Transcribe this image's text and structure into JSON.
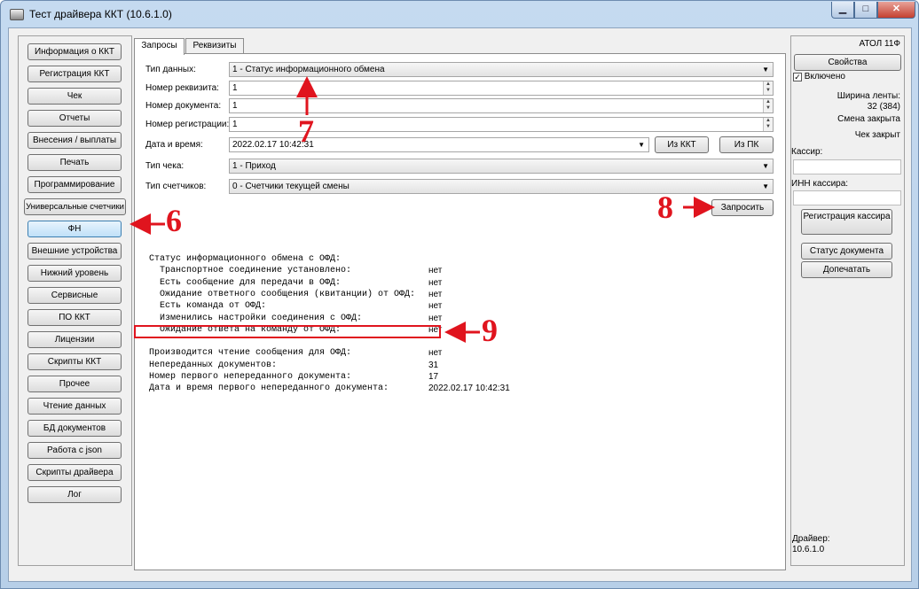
{
  "window": {
    "title": "Тест драйвера ККТ (10.6.1.0)",
    "min_glyph": "▁",
    "max_glyph": "□",
    "close_glyph": "✕"
  },
  "nav": {
    "items": [
      {
        "label": "Информация о ККТ"
      },
      {
        "label": "Регистрация ККТ"
      },
      {
        "label": "Чек"
      },
      {
        "label": "Отчеты"
      },
      {
        "label": "Внесения / выплаты"
      },
      {
        "label": "Печать"
      },
      {
        "label": "Программирование"
      },
      {
        "label": "Универсальные счетчики"
      },
      {
        "label": "ФН",
        "active": true
      },
      {
        "label": "Внешние устройства"
      },
      {
        "label": "Нижний уровень"
      },
      {
        "label": "Сервисные"
      },
      {
        "label": "ПО ККТ"
      },
      {
        "label": "Лицензии"
      },
      {
        "label": "Скрипты ККТ"
      },
      {
        "label": "Прочее"
      },
      {
        "label": "Чтение данных"
      },
      {
        "label": "БД документов"
      },
      {
        "label": "Работа с json"
      },
      {
        "label": "Скрипты драйвера"
      },
      {
        "label": "Лог"
      }
    ]
  },
  "tabs": {
    "requests": "Запросы",
    "requisites": "Реквизиты",
    "active": "requests"
  },
  "form": {
    "data_type_label": "Тип данных:",
    "data_type_value": "1 - Статус информационного обмена",
    "requisite_no_label": "Номер реквизита:",
    "requisite_no_value": "1",
    "document_no_label": "Номер документа:",
    "document_no_value": "1",
    "registration_no_label": "Номер регистрации:",
    "registration_no_value": "1",
    "datetime_label": "Дата и время:",
    "datetime_value": "2022.02.17 10:42:31",
    "from_kkt_button": "Из ККТ",
    "from_pc_button": "Из ПК",
    "receipt_type_label": "Тип чека:",
    "receipt_type_value": "1 - Приход",
    "counters_type_label": "Тип счетчиков:",
    "counters_type_value": "0 - Счетчики текущей смены",
    "request_button": "Запросить"
  },
  "output": {
    "rows": [
      {
        "key": "Статус информационного обмена с ОФД:",
        "value": ""
      },
      {
        "key": "  Транспортное соединение установлено:",
        "value": "нет"
      },
      {
        "key": "  Есть сообщение для передачи в ОФД:",
        "value": "нет"
      },
      {
        "key": "  Ожидание ответного сообщения (квитанции) от ОФД:",
        "value": "нет"
      },
      {
        "key": "  Есть команда от ОФД:",
        "value": "нет"
      },
      {
        "key": "  Изменились настройки соединения с ОФД:",
        "value": "нет"
      },
      {
        "key": "  Ожидание ответа на команду от ОФД:",
        "value": "нет"
      },
      {
        "key": "",
        "value": ""
      },
      {
        "key": "Производится чтение сообщения для ОФД:",
        "value": "нет"
      },
      {
        "key": "Непереданных документов:",
        "value": "31",
        "highlight": true
      },
      {
        "key": "Номер первого непереданного документа:",
        "value": "17"
      },
      {
        "key": "Дата и время первого непереданного документа:",
        "value": "2022.02.17 10:42:31"
      }
    ]
  },
  "right": {
    "model": "АТОЛ 11Ф",
    "properties_button": "Свойства",
    "enabled_label": "Включено",
    "enabled": true,
    "tape_width_label": "Ширина ленты:",
    "tape_width_value": "32 (384)",
    "shift_status": "Смена закрыта",
    "receipt_status": "Чек закрыт",
    "cashier_label": "Кассир:",
    "cashier_value": "",
    "cashier_inn_label": "ИНН кассира:",
    "cashier_inn_value": "",
    "register_cashier_button": "Регистрация кассира",
    "doc_status_button": "Статус документа",
    "reprint_button": "Допечатать",
    "driver_label": "Драйвер:",
    "driver_version": "10.6.1.0"
  },
  "annotations": {
    "n6": "6",
    "n7": "7",
    "n8": "8",
    "n9": "9",
    "color": "#e0141e"
  },
  "colors": {
    "title_bar": "#c5daf0",
    "active_nav": "#bfe0f8",
    "highlight": "#e0141e"
  }
}
